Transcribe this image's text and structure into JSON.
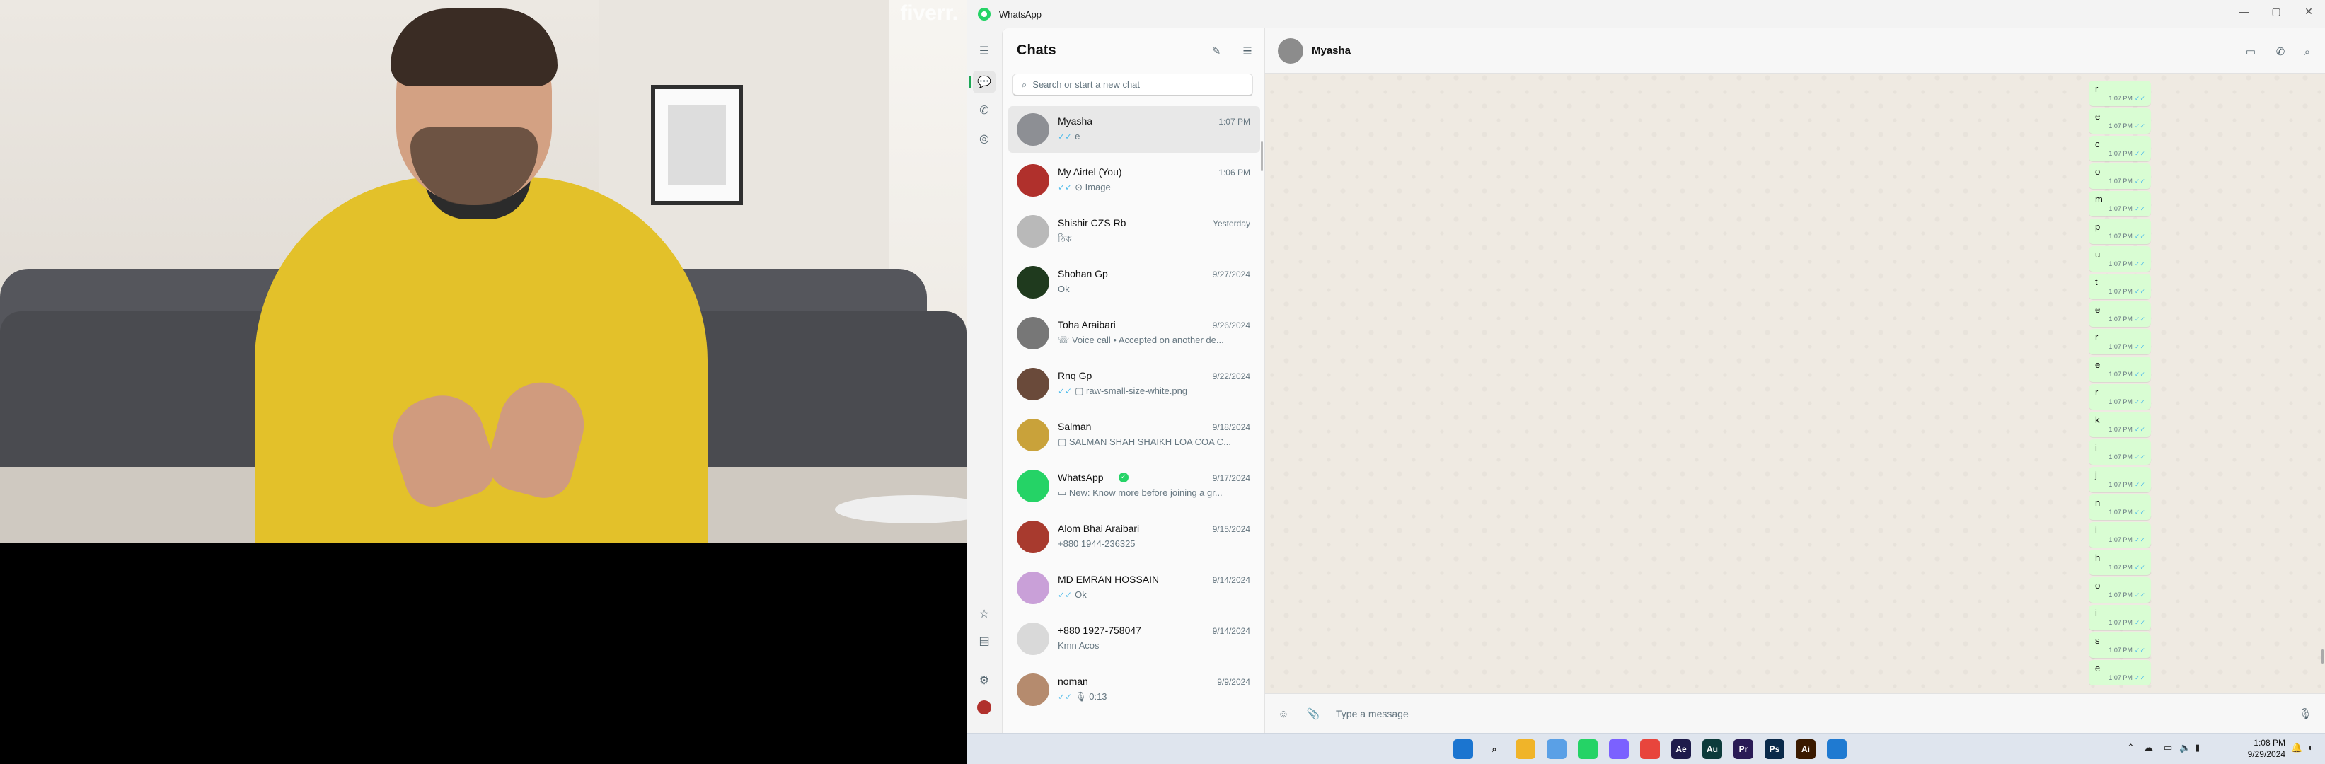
{
  "video": {
    "watermark": "fiverr."
  },
  "window": {
    "title": "WhatsApp"
  },
  "chatlist": {
    "title": "Chats",
    "search_placeholder": "Search or start a new chat",
    "chats": [
      {
        "name": "Myasha",
        "time": "1:07 PM",
        "message": "e",
        "tick": "✓✓",
        "color": "#8d8f94",
        "selected": true
      },
      {
        "name": "My Airtel (You)",
        "time": "1:06 PM",
        "message": "⊙ Image",
        "tick": "✓✓",
        "color": "#b0302c"
      },
      {
        "name": "Shishir CZS Rb",
        "time": "Yesterday",
        "message": "ঠিক",
        "tick": "",
        "color": "#b9b9b9"
      },
      {
        "name": "Shohan Gp",
        "time": "9/27/2024",
        "message": "Ok",
        "tick": "",
        "color": "#1f3a1e"
      },
      {
        "name": "Toha Araibari",
        "time": "9/26/2024",
        "message": "☏ Voice call • Accepted on another de...",
        "tick": "",
        "color": "#777777"
      },
      {
        "name": "Rnq Gp",
        "time": "9/22/2024",
        "message": "▢ raw-small-size-white.png",
        "tick": "✓✓",
        "color": "#6a4a3a"
      },
      {
        "name": "Salman",
        "time": "9/18/2024",
        "message": "▢ SALMAN SHAH SHAIKH LOA COA C...",
        "tick": "",
        "color": "#c9a23a"
      },
      {
        "name": "WhatsApp",
        "time": "9/17/2024",
        "message": "▭ New: Know more before joining a gr...",
        "tick": "",
        "color": "#25d366",
        "verified": true
      },
      {
        "name": "Alom Bhai Araibari",
        "time": "9/15/2024",
        "message": "+880 1944-236325",
        "tick": "",
        "color": "#a83a2e"
      },
      {
        "name": "MD EMRAN HOSSAIN",
        "time": "9/14/2024",
        "message": "Ok",
        "tick": "✓✓",
        "color": "#c9a0d8"
      },
      {
        "name": "+880 1927-758047",
        "time": "9/14/2024",
        "message": "Kmn Acos",
        "tick": "",
        "color": "#d9d9d9"
      },
      {
        "name": "noman",
        "time": "9/9/2024",
        "message": "🎙 0:13",
        "tick": "✓✓",
        "color": "#b58b6e"
      }
    ]
  },
  "conversation": {
    "contact": "Myasha",
    "messages": [
      {
        "text": "r",
        "time": "1:07 PM"
      },
      {
        "text": "e",
        "time": "1:07 PM"
      },
      {
        "text": "c",
        "time": "1:07 PM"
      },
      {
        "text": "o",
        "time": "1:07 PM"
      },
      {
        "text": "m",
        "time": "1:07 PM"
      },
      {
        "text": "p",
        "time": "1:07 PM"
      },
      {
        "text": "u",
        "time": "1:07 PM"
      },
      {
        "text": "t",
        "time": "1:07 PM"
      },
      {
        "text": "e",
        "time": "1:07 PM"
      },
      {
        "text": "r",
        "time": "1:07 PM"
      },
      {
        "text": "e",
        "time": "1:07 PM"
      },
      {
        "text": "r",
        "time": "1:07 PM"
      },
      {
        "text": "k",
        "time": "1:07 PM"
      },
      {
        "text": "i",
        "time": "1:07 PM"
      },
      {
        "text": "j",
        "time": "1:07 PM"
      },
      {
        "text": "n",
        "time": "1:07 PM"
      },
      {
        "text": "i",
        "time": "1:07 PM"
      },
      {
        "text": "h",
        "time": "1:07 PM"
      },
      {
        "text": "o",
        "time": "1:07 PM"
      },
      {
        "text": "i",
        "time": "1:07 PM"
      },
      {
        "text": "s",
        "time": "1:07 PM"
      },
      {
        "text": "e",
        "time": "1:07 PM"
      }
    ],
    "composer_placeholder": "Type a message"
  },
  "taskbar": {
    "apps": [
      {
        "icon": "windows-start-icon",
        "label": "",
        "color": "#1b75d0"
      },
      {
        "icon": "search-icon",
        "label": "⌕",
        "color": "#dfe5ee"
      },
      {
        "icon": "file-explorer-icon",
        "label": "",
        "color": "#f0b429"
      },
      {
        "icon": "folder-icon",
        "label": "",
        "color": "#5aa0e6"
      },
      {
        "icon": "whatsapp-icon",
        "label": "",
        "color": "#25d366"
      },
      {
        "icon": "app-diamond-icon",
        "label": "",
        "color": "#7b61ff"
      },
      {
        "icon": "chrome-icon",
        "label": "",
        "color": "#e8453c"
      },
      {
        "icon": "after-effects-icon",
        "label": "Ae",
        "color": "#1e1b4b"
      },
      {
        "icon": "audition-icon",
        "label": "Au",
        "color": "#0d3b3b"
      },
      {
        "icon": "premiere-icon",
        "label": "Pr",
        "color": "#2a1b55"
      },
      {
        "icon": "photoshop-icon",
        "label": "Ps",
        "color": "#0a2a4a"
      },
      {
        "icon": "illustrator-icon",
        "label": "Ai",
        "color": "#3a1a00"
      },
      {
        "icon": "vscode-icon",
        "label": "",
        "color": "#1f7ad1"
      }
    ],
    "time": "1:08 PM",
    "date": "9/29/2024"
  }
}
